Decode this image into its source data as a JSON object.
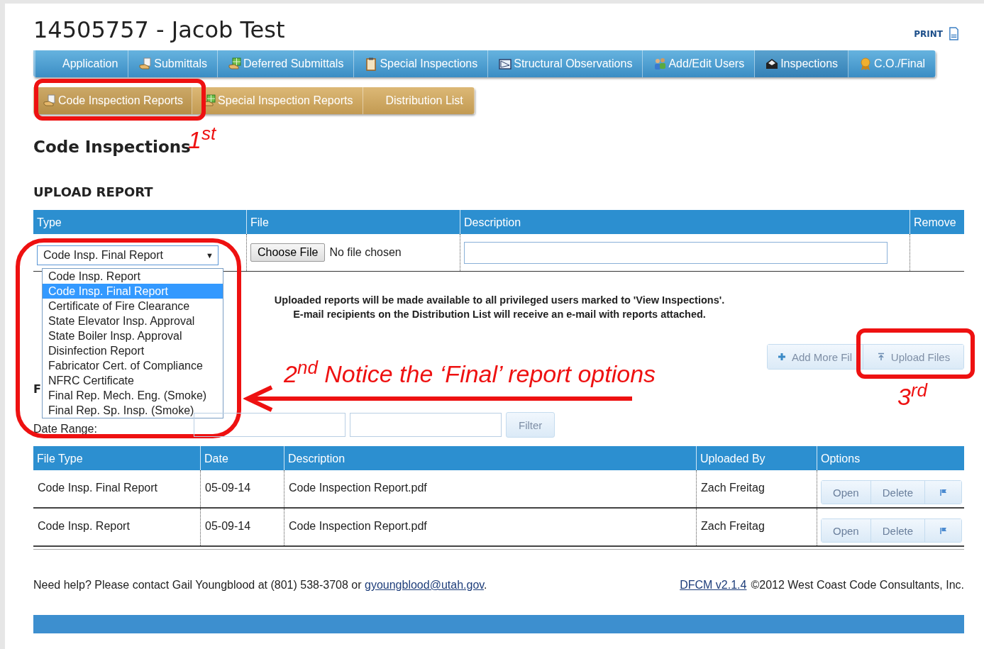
{
  "title": "14505757 - Jacob Test",
  "print_link": "PRINT",
  "main_tabs": [
    {
      "label": "Application",
      "selected": false
    },
    {
      "label": "Submittals",
      "selected": false
    },
    {
      "label": "Deferred Submittals",
      "selected": false
    },
    {
      "label": "Special Inspections",
      "selected": false
    },
    {
      "label": "Structural Observations",
      "selected": false
    },
    {
      "label": "Add/Edit Users",
      "selected": false
    },
    {
      "label": "Inspections",
      "selected": true
    },
    {
      "label": "C.O./Final",
      "selected": false
    }
  ],
  "sub_tabs": [
    {
      "label": "Code Inspection Reports",
      "selected": true
    },
    {
      "label": "Special Inspection Reports",
      "selected": false
    },
    {
      "label": "Distribution List",
      "selected": false
    }
  ],
  "section_title": "Code Inspections",
  "upload": {
    "title": "UPLOAD REPORT",
    "columns": [
      "Type",
      "File",
      "Description",
      "Remove"
    ],
    "type_select": {
      "value": "Code Insp. Final Report",
      "caret": "▼",
      "expanded": true,
      "options": [
        {
          "label": "Code Insp. Report",
          "selected": false
        },
        {
          "label": "Code Insp. Final Report",
          "selected": true
        },
        {
          "label": "Certificate of Fire Clearance",
          "selected": false
        },
        {
          "label": "State Elevator Insp. Approval",
          "selected": false
        },
        {
          "label": "State Boiler Insp. Approval",
          "selected": false
        },
        {
          "label": "Disinfection Report",
          "selected": false
        },
        {
          "label": "Fabricator Cert. of Compliance",
          "selected": false
        },
        {
          "label": "NFRC Certificate",
          "selected": false
        },
        {
          "label": "Final Rep. Mech. Eng. (Smoke)",
          "selected": false
        },
        {
          "label": "Final Rep. Sp. Insp. (Smoke)",
          "selected": false
        }
      ]
    },
    "choose_file_button": "Choose File",
    "file_status": "No file chosen",
    "notice": [
      "Uploaded reports will be made available to all privileged users marked to 'View Inspections'.",
      "E-mail recipients on the Distribution List will receive an e-mail with reports attached."
    ],
    "add_more_button": "Add More Fil",
    "upload_button": "Upload Files"
  },
  "filter": {
    "heading": "F",
    "label": "Date Range:",
    "button": "Filter"
  },
  "files": {
    "columns": [
      "File Type",
      "Date",
      "Description",
      "Uploaded By",
      "Options"
    ],
    "rows": [
      {
        "type": "Code Insp. Final Report",
        "date": "05-09-14",
        "description": "Code Inspection Report.pdf",
        "uploaded_by": "Zach Freitag",
        "actions": [
          "Open",
          "Delete"
        ]
      },
      {
        "type": "Code Insp. Report",
        "date": "05-09-14",
        "description": "Code Inspection Report.pdf",
        "uploaded_by": "Zach Freitag",
        "actions": [
          "Open",
          "Delete"
        ]
      }
    ]
  },
  "footer": {
    "help_text": "Need help? Please contact Gail Youngblood at (801) 538-3708 or ",
    "email_link": "gyoungblood@utah.gov",
    "help_end": ".",
    "version_link": "DFCM v2.1.4",
    "copyright": "©2012 West Coast Code Consultants, Inc."
  },
  "annotations": [
    {
      "kind": "step",
      "text": "1$^{st}$"
    },
    {
      "kind": "step",
      "text": "2$^{nd}$ Notice the ‘Final’ report options"
    },
    {
      "kind": "step",
      "text": "3$^{rd}$"
    }
  ]
}
